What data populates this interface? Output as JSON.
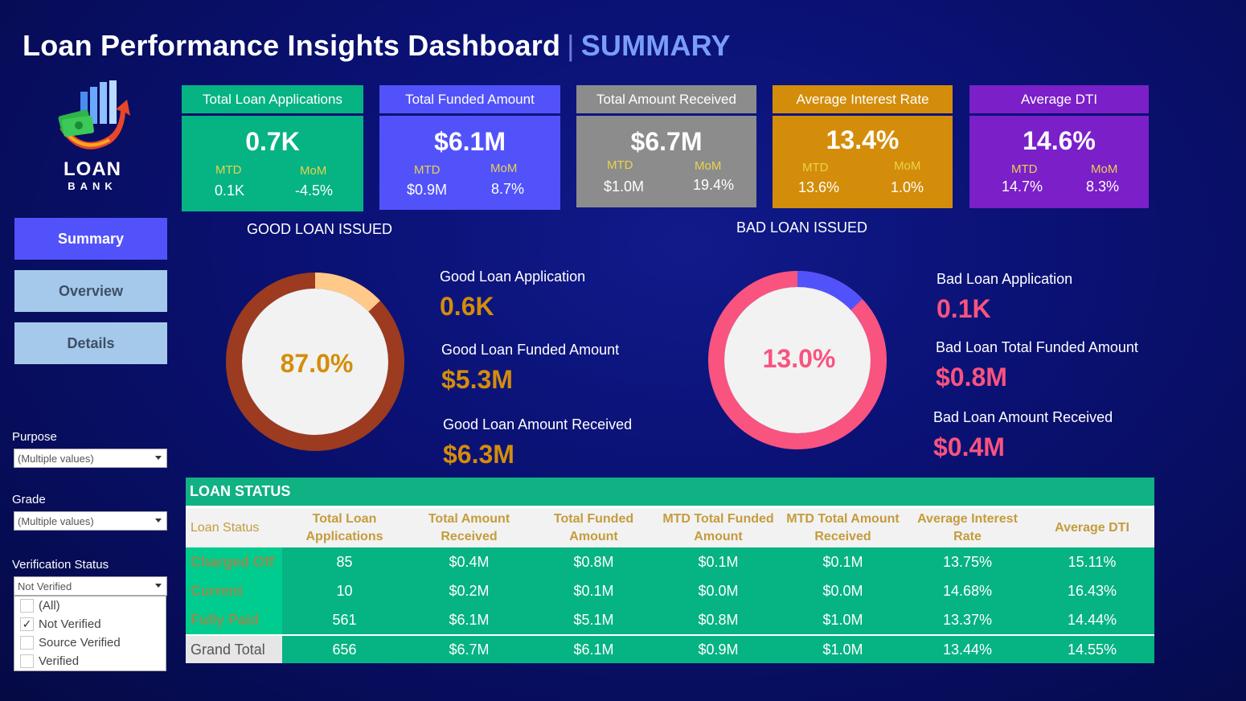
{
  "header": {
    "title": "Loan Performance Insights Dashboard",
    "separator": "|",
    "subtitle": "SUMMARY"
  },
  "logo": {
    "text": "LOAN",
    "subtext": "BANK"
  },
  "nav": {
    "summary": "Summary",
    "overview": "Overview",
    "details": "Details"
  },
  "filters": {
    "purpose": {
      "label": "Purpose",
      "value": "(Multiple values)"
    },
    "grade": {
      "label": "Grade",
      "value": "(Multiple values)"
    },
    "verification": {
      "label": "Verification Status",
      "value": "Not Verified",
      "options": [
        {
          "label": "(All)",
          "checked": false
        },
        {
          "label": "Not Verified",
          "checked": true
        },
        {
          "label": "Source Verified",
          "checked": false
        },
        {
          "label": "Verified",
          "checked": false
        }
      ]
    }
  },
  "kpis": [
    {
      "title": "Total Loan Applications",
      "value": "0.7K",
      "mtd_label": "MTD",
      "mtd": "0.1K",
      "mom_label": "MoM",
      "mom": "-4.5%",
      "head_color": "#06b383",
      "body_color": "#06b383"
    },
    {
      "title": "Total Funded Amount",
      "value": "$6.1M",
      "mtd_label": "MTD",
      "mtd": "$0.9M",
      "mom_label": "MoM",
      "mom": "8.7%",
      "head_color": "#5252fb",
      "body_color": "#5252fb"
    },
    {
      "title": "Total Amount Received",
      "value": "$6.7M",
      "mtd_label": "MTD",
      "mtd": "$1.0M",
      "mom_label": "MoM",
      "mom": "19.4%",
      "head_color": "#8c8c8c",
      "body_color": "#8c8c8c"
    },
    {
      "title": "Average Interest Rate",
      "value": "13.4%",
      "mtd_label": "MTD",
      "mtd": "13.6%",
      "mom_label": "MoM",
      "mom": "1.0%",
      "head_color": "#d48d0a",
      "body_color": "#d48d0a"
    },
    {
      "title": "Average DTI",
      "value": "14.6%",
      "mtd_label": "MTD",
      "mtd": "14.7%",
      "mom_label": "MoM",
      "mom": "8.3%",
      "head_color": "#7b1fc9",
      "body_color": "#7b1fc9"
    }
  ],
  "good_loan": {
    "section_title": "GOOD LOAN ISSUED",
    "percent_label": "87.0%",
    "percent": 0.87,
    "ring_color": "#9c3b1f",
    "remainder_color": "#ffc98a",
    "app_label": "Good Loan Application",
    "app_value": "0.6K",
    "funded_label": "Good Loan Funded Amount",
    "funded_value": "$5.3M",
    "received_label": "Good Loan Amount Received",
    "received_value": "$6.3M"
  },
  "bad_loan": {
    "section_title": "BAD LOAN ISSUED",
    "percent_label": "13.0%",
    "percent": 0.13,
    "ring_color": "#5252fb",
    "remainder_color": "#f9537f",
    "app_label": "Bad Loan Application",
    "app_value": "0.1K",
    "funded_label": "Bad Loan Total Funded Amount",
    "funded_value": "$0.8M",
    "received_label": "Bad Loan Amount Received",
    "received_value": "$0.4M"
  },
  "table": {
    "title": "LOAN STATUS",
    "columns": [
      "Loan Status",
      "Total Loan Applications",
      "Total Amount Received",
      "Total Funded Amount",
      "MTD Total Funded Amount",
      "MTD Total Amount Received",
      "Average Interest Rate",
      "Average DTI"
    ],
    "rows": [
      [
        "Charged Off",
        "85",
        "$0.4M",
        "$0.8M",
        "$0.1M",
        "$0.1M",
        "13.75%",
        "15.11%"
      ],
      [
        "Current",
        "10",
        "$0.2M",
        "$0.1M",
        "$0.0M",
        "$0.0M",
        "14.68%",
        "16.43%"
      ],
      [
        "Fully Paid",
        "561",
        "$6.1M",
        "$5.1M",
        "$0.8M",
        "$1.0M",
        "13.37%",
        "14.44%"
      ]
    ],
    "total": [
      "Grand Total",
      "656",
      "$6.7M",
      "$6.1M",
      "$0.9M",
      "$1.0M",
      "13.44%",
      "14.55%"
    ]
  }
}
